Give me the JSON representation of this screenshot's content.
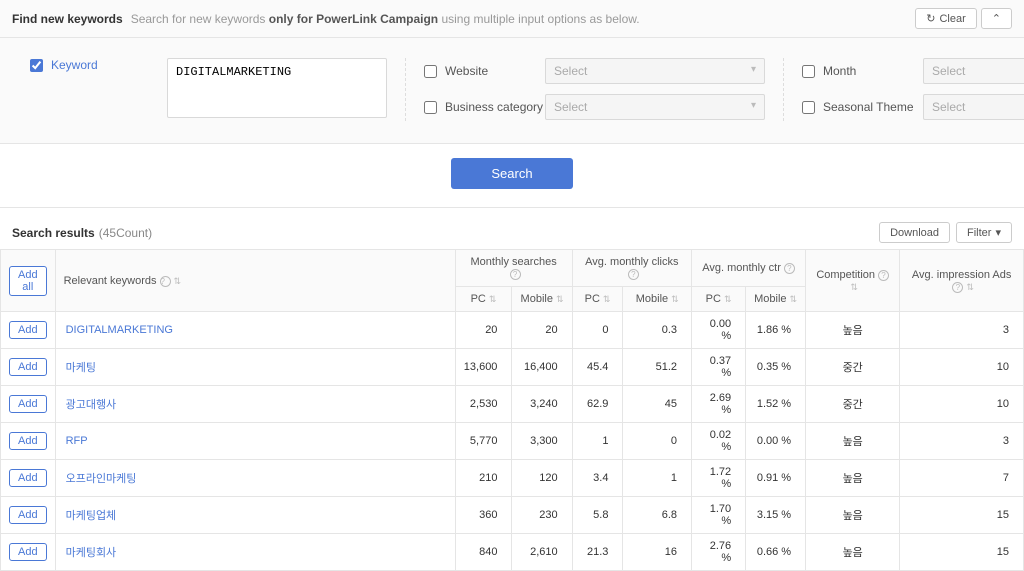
{
  "header": {
    "title": "Find new keywords",
    "desc_prefix": "Search for new keywords ",
    "desc_bold": "only for PowerLink Campaign",
    "desc_suffix": " using multiple input options as below.",
    "clear_label": "Clear",
    "collapse_icon": "⌃"
  },
  "filters": {
    "keyword_label": "Keyword",
    "keyword_value": "DIGITALMARKETING",
    "website_label": "Website",
    "biz_label": "Business category",
    "month_label": "Month",
    "season_label": "Seasonal Theme",
    "select_placeholder": "Select"
  },
  "search_label": "Search",
  "results": {
    "title": "Search results",
    "count_text": "(45Count)",
    "download_label": "Download",
    "filter_label": "Filter"
  },
  "table": {
    "add_all": "Add all",
    "add_label": "Add",
    "cols": {
      "relevant": "Relevant keywords",
      "monthly_searches": "Monthly searches",
      "avg_clicks": "Avg. monthly clicks",
      "avg_ctr": "Avg. monthly ctr",
      "competition": "Competition",
      "impressions": "Avg. impression Ads",
      "pc": "PC",
      "mobile": "Mobile"
    },
    "rows": [
      {
        "kw": "DIGITALMARKETING",
        "pc_s": "20",
        "mb_s": "20",
        "pc_c": "0",
        "mb_c": "0.3",
        "pc_r": "0.00 %",
        "mb_r": "1.86 %",
        "comp": "높음",
        "imp": "3"
      },
      {
        "kw": "마케팅",
        "pc_s": "13,600",
        "mb_s": "16,400",
        "pc_c": "45.4",
        "mb_c": "51.2",
        "pc_r": "0.37 %",
        "mb_r": "0.35 %",
        "comp": "중간",
        "imp": "10"
      },
      {
        "kw": "광고대행사",
        "pc_s": "2,530",
        "mb_s": "3,240",
        "pc_c": "62.9",
        "mb_c": "45",
        "pc_r": "2.69 %",
        "mb_r": "1.52 %",
        "comp": "중간",
        "imp": "10"
      },
      {
        "kw": "RFP",
        "pc_s": "5,770",
        "mb_s": "3,300",
        "pc_c": "1",
        "mb_c": "0",
        "pc_r": "0.02 %",
        "mb_r": "0.00 %",
        "comp": "높음",
        "imp": "3"
      },
      {
        "kw": "오프라인마케팅",
        "pc_s": "210",
        "mb_s": "120",
        "pc_c": "3.4",
        "mb_c": "1",
        "pc_r": "1.72 %",
        "mb_r": "0.91 %",
        "comp": "높음",
        "imp": "7"
      },
      {
        "kw": "마케팅업체",
        "pc_s": "360",
        "mb_s": "230",
        "pc_c": "5.8",
        "mb_c": "6.8",
        "pc_r": "1.70 %",
        "mb_r": "3.15 %",
        "comp": "높음",
        "imp": "15"
      },
      {
        "kw": "마케팅회사",
        "pc_s": "840",
        "mb_s": "2,610",
        "pc_c": "21.3",
        "mb_c": "16",
        "pc_r": "2.76 %",
        "mb_r": "0.66 %",
        "comp": "높음",
        "imp": "15"
      }
    ]
  }
}
